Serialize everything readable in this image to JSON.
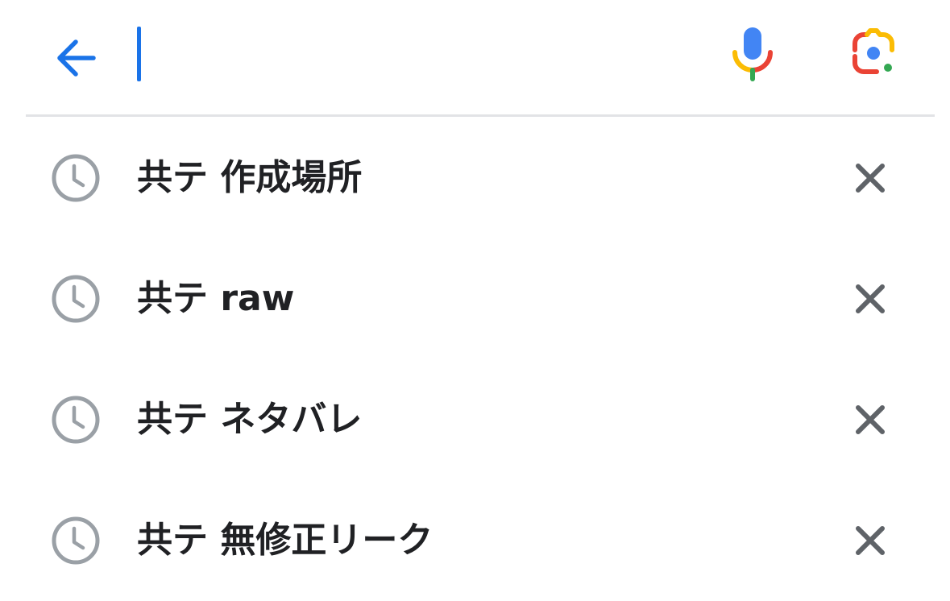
{
  "search": {
    "value": "",
    "placeholder": ""
  },
  "icons": {
    "back": "arrow-back-icon",
    "voice": "mic-icon",
    "lens": "google-lens-icon",
    "history": "history-clock-icon",
    "remove": "close-icon"
  },
  "colors": {
    "accent": "#1a73e8",
    "text": "#202124",
    "icon_gray": "#9aa0a6",
    "close_gray": "#5f6368",
    "google_blue": "#4285f4",
    "google_red": "#ea4335",
    "google_yellow": "#fbbc04",
    "google_green": "#34a853"
  },
  "suggestions": [
    {
      "text": "共テ 作成場所"
    },
    {
      "text": "共テ raw"
    },
    {
      "text": "共テ ネタバレ"
    },
    {
      "text": "共テ 無修正リーク"
    }
  ]
}
